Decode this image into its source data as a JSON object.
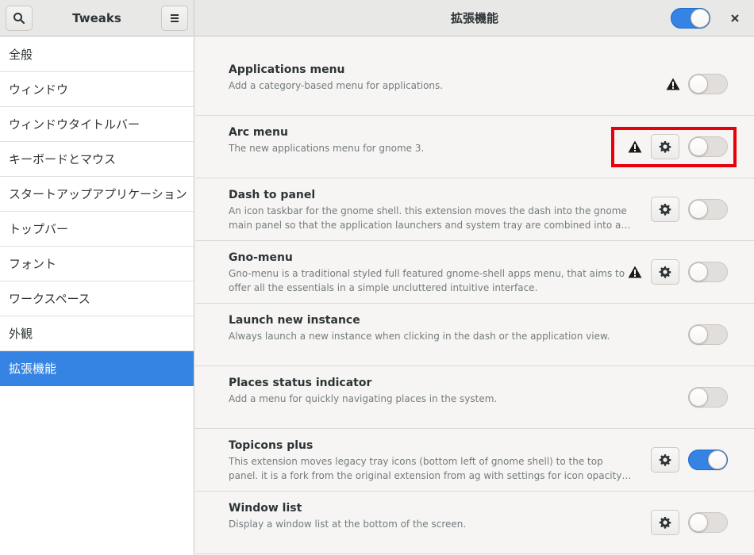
{
  "header": {
    "app_title": "Tweaks",
    "page_title": "拡張機能",
    "extensions_enabled": true
  },
  "sidebar": {
    "items": [
      {
        "label": "全般"
      },
      {
        "label": "ウィンドウ"
      },
      {
        "label": "ウィンドウタイトルバー"
      },
      {
        "label": "キーボードとマウス"
      },
      {
        "label": "スタートアップアプリケーション"
      },
      {
        "label": "トップバー"
      },
      {
        "label": "フォント"
      },
      {
        "label": "ワークスペース"
      },
      {
        "label": "外観"
      },
      {
        "label": "拡張機能",
        "selected": true
      }
    ]
  },
  "extensions": [
    {
      "name": "Applications menu",
      "description": "Add a category-based menu for applications.",
      "warning": true,
      "settings": false,
      "enabled": false
    },
    {
      "name": "Arc menu",
      "description": "The new applications menu for gnome 3.",
      "warning": true,
      "settings": true,
      "enabled": false
    },
    {
      "name": "Dash to panel",
      "description": "An icon taskbar for the gnome shell. this extension moves the dash into the gnome main panel so that the application launchers and system tray are combined into a single panel, si…",
      "warning": false,
      "settings": true,
      "enabled": false
    },
    {
      "name": "Gno-menu",
      "description": "Gno-menu is a traditional styled full featured gnome-shell apps menu, that aims to offer all the essentials in a simple uncluttered intuitive interface.",
      "warning": true,
      "settings": true,
      "enabled": false
    },
    {
      "name": "Launch new instance",
      "description": "Always launch a new instance when clicking in the dash or the application view.",
      "warning": false,
      "settings": false,
      "enabled": false
    },
    {
      "name": "Places status indicator",
      "description": "Add a menu for quickly navigating places in the system.",
      "warning": false,
      "settings": false,
      "enabled": false
    },
    {
      "name": "Topicons plus",
      "description": "This extension moves legacy tray icons (bottom left of gnome shell) to the top panel. it is a fork from the original extension from ag  with settings for icon opacity, saturation, padding, …",
      "warning": false,
      "settings": true,
      "enabled": true
    },
    {
      "name": "Window list",
      "description": "Display a window list at the bottom of the screen.",
      "warning": false,
      "settings": true,
      "enabled": false
    }
  ],
  "icons": {
    "search": "search-icon",
    "menu": "hamburger-menu-icon",
    "close": "close-icon",
    "settings": "gear-icon",
    "warning": "warning-icon"
  },
  "colors": {
    "accent": "#3584e4",
    "highlight": "#e8000b"
  }
}
